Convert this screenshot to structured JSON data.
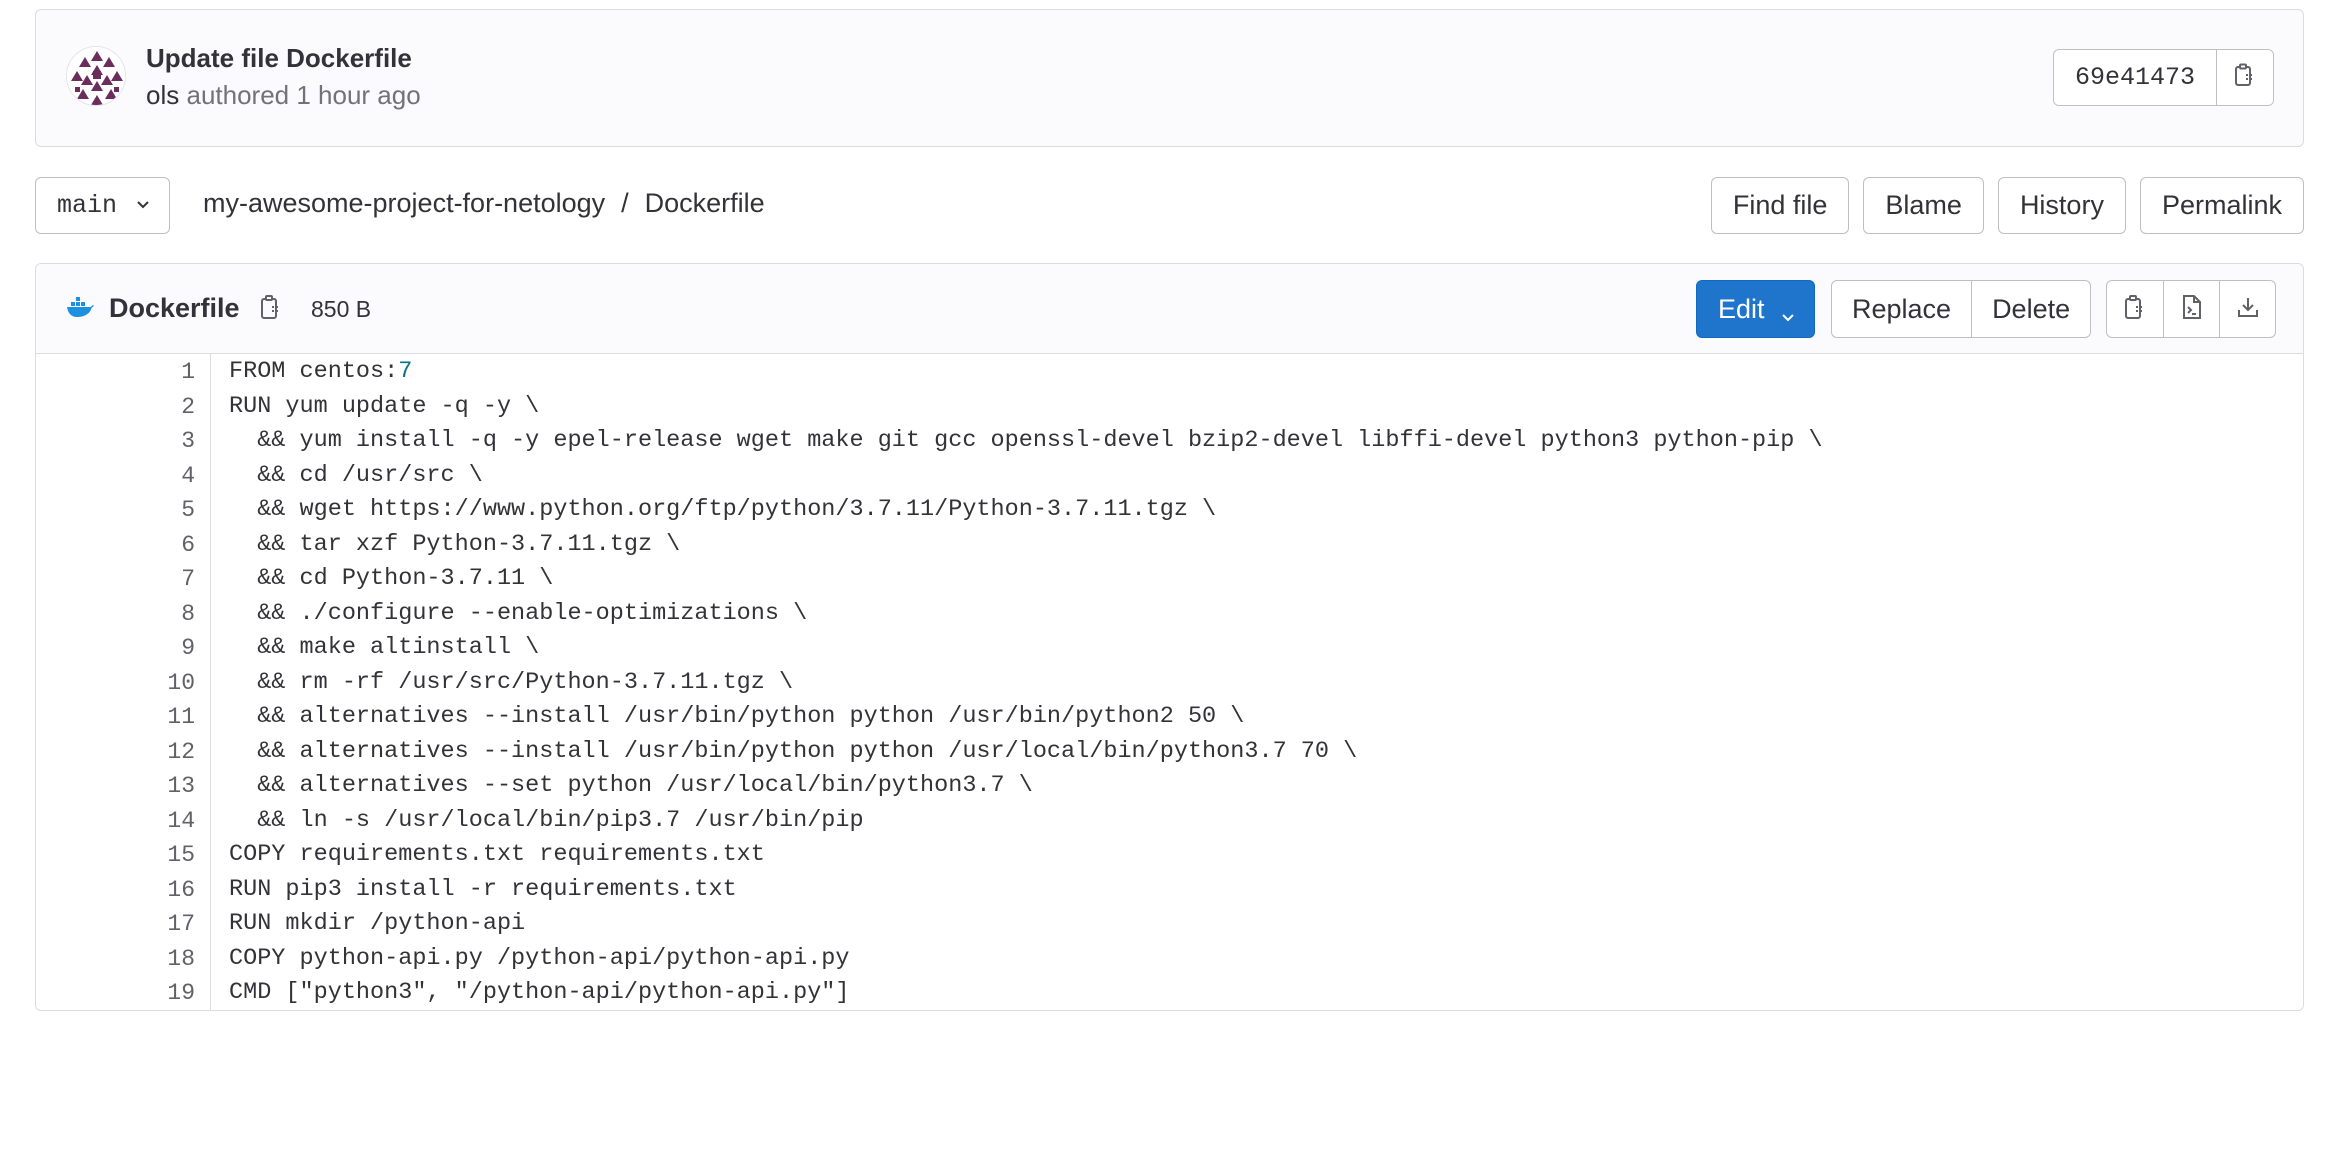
{
  "commit": {
    "title": "Update file Dockerfile",
    "author": "ols",
    "meta": "authored 1 hour ago",
    "sha": "69e41473"
  },
  "nav": {
    "branch": "main",
    "project": "my-awesome-project-for-netology",
    "separator": "/",
    "file": "Dockerfile",
    "actions": [
      "Find file",
      "Blame",
      "History",
      "Permalink"
    ]
  },
  "file": {
    "name": "Dockerfile",
    "size": "850 B",
    "edit_label": "Edit",
    "replace_label": "Replace",
    "delete_label": "Delete",
    "icons": [
      "clipboard-icon",
      "raw-file-icon",
      "download-icon"
    ]
  },
  "code": {
    "line_numbers": [
      "1",
      "2",
      "3",
      "4",
      "5",
      "6",
      "7",
      "8",
      "9",
      "10",
      "11",
      "12",
      "13",
      "14",
      "15",
      "16",
      "17",
      "18",
      "19"
    ],
    "line1_prefix": "FROM centos:",
    "line1_tag": "7",
    "lines": [
      "RUN yum update -q -y \\",
      "  && yum install -q -y epel-release wget make git gcc openssl-devel bzip2-devel libffi-devel python3 python-pip \\",
      "  && cd /usr/src \\",
      "  && wget https://www.python.org/ftp/python/3.7.11/Python-3.7.11.tgz \\",
      "  && tar xzf Python-3.7.11.tgz \\",
      "  && cd Python-3.7.11 \\",
      "  && ./configure --enable-optimizations \\",
      "  && make altinstall \\",
      "  && rm -rf /usr/src/Python-3.7.11.tgz \\",
      "  && alternatives --install /usr/bin/python python /usr/bin/python2 50 \\",
      "  && alternatives --install /usr/bin/python python /usr/local/bin/python3.7 70 \\",
      "  && alternatives --set python /usr/local/bin/python3.7 \\",
      "  && ln -s /usr/local/bin/pip3.7 /usr/bin/pip",
      "COPY requirements.txt requirements.txt",
      "RUN pip3 install -r requirements.txt",
      "RUN mkdir /python-api",
      "COPY python-api.py /python-api/python-api.py",
      "CMD [\"python3\", \"/python-api/python-api.py\"]"
    ]
  },
  "colors": {
    "primary": "#1f75cb",
    "docker": "#1d91e0",
    "avatar": "#6b2d5c"
  }
}
